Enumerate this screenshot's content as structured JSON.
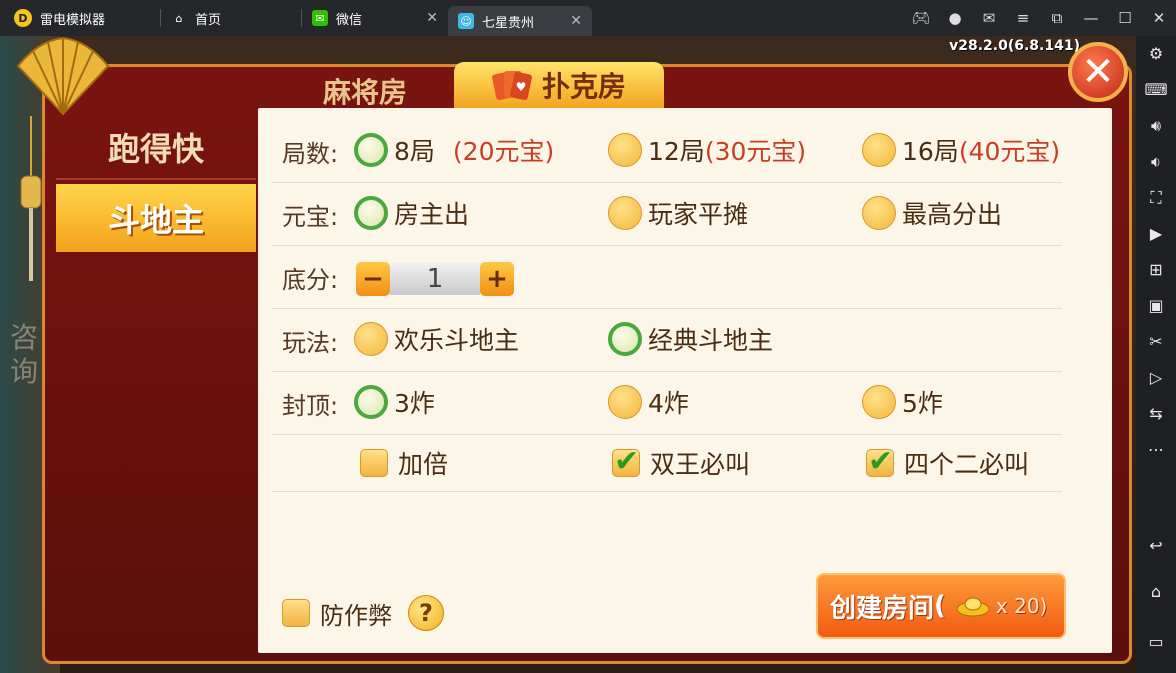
{
  "window": {
    "app_name": "雷电模拟器",
    "tabs": [
      {
        "label": "首页"
      },
      {
        "label": "微信"
      },
      {
        "label": "七星贵州"
      }
    ]
  },
  "game": {
    "version": "v28.2.0(6.8.141)",
    "bg_consult": "咨\n询",
    "top_tabs": {
      "mahjong": "麻将房",
      "poker": "扑克房"
    },
    "left_menu": {
      "paodekuai": "跑得快",
      "doudizhu": "斗地主"
    },
    "rows": {
      "rounds": {
        "label": "局数:",
        "options": [
          {
            "main": "8局",
            "extra": "(20元宝)",
            "selected": true
          },
          {
            "main": "12局",
            "extra": "(30元宝)",
            "selected": false
          },
          {
            "main": "16局",
            "extra": "(40元宝)",
            "selected": false
          }
        ]
      },
      "payment": {
        "label": "元宝:",
        "options": [
          {
            "main": "房主出",
            "selected": true
          },
          {
            "main": "玩家平摊",
            "selected": false
          },
          {
            "main": "最高分出",
            "selected": false
          }
        ]
      },
      "base_score": {
        "label": "底分:",
        "minus": "−",
        "value": "1",
        "plus": "+"
      },
      "mode": {
        "label": "玩法:",
        "options": [
          {
            "main": "欢乐斗地主",
            "selected": false
          },
          {
            "main": "经典斗地主",
            "selected": true
          }
        ]
      },
      "cap": {
        "label": "封顶:",
        "options": [
          {
            "main": "3炸",
            "selected": true
          },
          {
            "main": "4炸",
            "selected": false
          },
          {
            "main": "5炸",
            "selected": false
          }
        ]
      },
      "extras": [
        {
          "label": "加倍",
          "checked": false
        },
        {
          "label": "双王必叫",
          "checked": true
        },
        {
          "label": "四个二必叫",
          "checked": true
        }
      ]
    },
    "anticheat": {
      "label": "防作弊",
      "checked": false,
      "help": "?"
    },
    "create": {
      "label": "创建房间",
      "cost": "x 20)",
      "paren": "("
    }
  }
}
